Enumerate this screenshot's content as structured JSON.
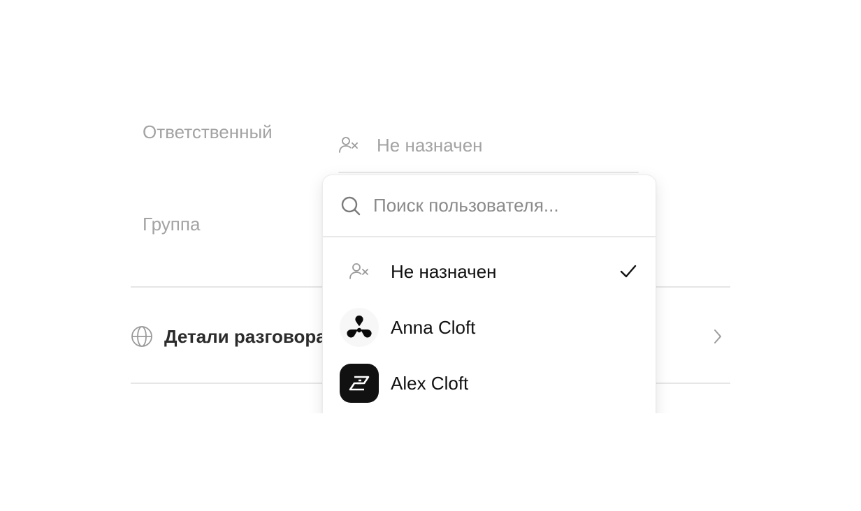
{
  "fields": {
    "responsible_label": "Ответственный",
    "group_label": "Группа",
    "assignee_value": "Не назначен"
  },
  "details": {
    "title": "Детали разговора"
  },
  "dropdown": {
    "search_placeholder": "Поиск пользователя...",
    "items": [
      {
        "name": "Не назначен",
        "icon": "user-x-icon",
        "selected": true
      },
      {
        "name": "Anna Cloft",
        "icon": "anna-avatar",
        "selected": false
      },
      {
        "name": "Alex Cloft",
        "icon": "alex-avatar",
        "selected": false
      }
    ]
  },
  "colors": {
    "muted_text": "#a3a3a3",
    "primary_text": "#111111",
    "divider": "#e6e6e6"
  }
}
